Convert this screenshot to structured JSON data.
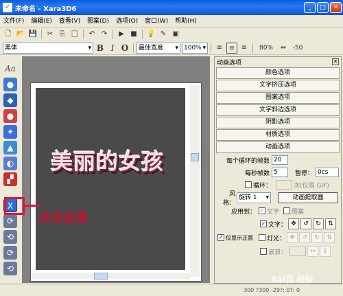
{
  "window": {
    "title": "未命名 - Xara3D6",
    "app_icon": "xara-logo-icon"
  },
  "menu": [
    "文件(F)",
    "编辑(E)",
    "查看(V)",
    "图案(D)",
    "选项(O)",
    "窗口(W)",
    "帮助(H)"
  ],
  "font_toolbar": {
    "font": "黑体",
    "bold": "B",
    "italic": "I",
    "outline": "O",
    "width_mode": "最佳宽度",
    "zoom": "100%",
    "line_spacing": "80%",
    "kerning": "-50"
  },
  "canvas": {
    "art_text": "美丽的女孩"
  },
  "annotation": {
    "text": "点击这里",
    "color": "#e2123a"
  },
  "panel": {
    "title": "动画选项",
    "close": "✕",
    "sections": [
      "颜色选项",
      "文字挤压选项",
      "图案选项",
      "文字斜边选项",
      "阴影选项",
      "材质选项",
      "动画选项"
    ],
    "frames_label": "每个循环的帧数",
    "frames_value": "20",
    "fps_label": "每秒帧数",
    "fps_value": "5",
    "pause_label": "暂停：",
    "pause_value": "0cs",
    "loop_label": "循环：",
    "loop_note": "次(仅限 GIF)",
    "style_label": "风格：",
    "style_value": "旋转 1",
    "extract_button": "动画提取器",
    "apply_label": "应用到：",
    "apply_text": "文字",
    "apply_pattern": "图案",
    "show_front_label": "仅显示正面",
    "text_label": "文字：",
    "light_label": "灯光：",
    "wave_label": "波浪："
  },
  "status": {
    "coords": "300 ?300 -29?: 0?: 0"
  },
  "watermark": "Bai百 经验"
}
